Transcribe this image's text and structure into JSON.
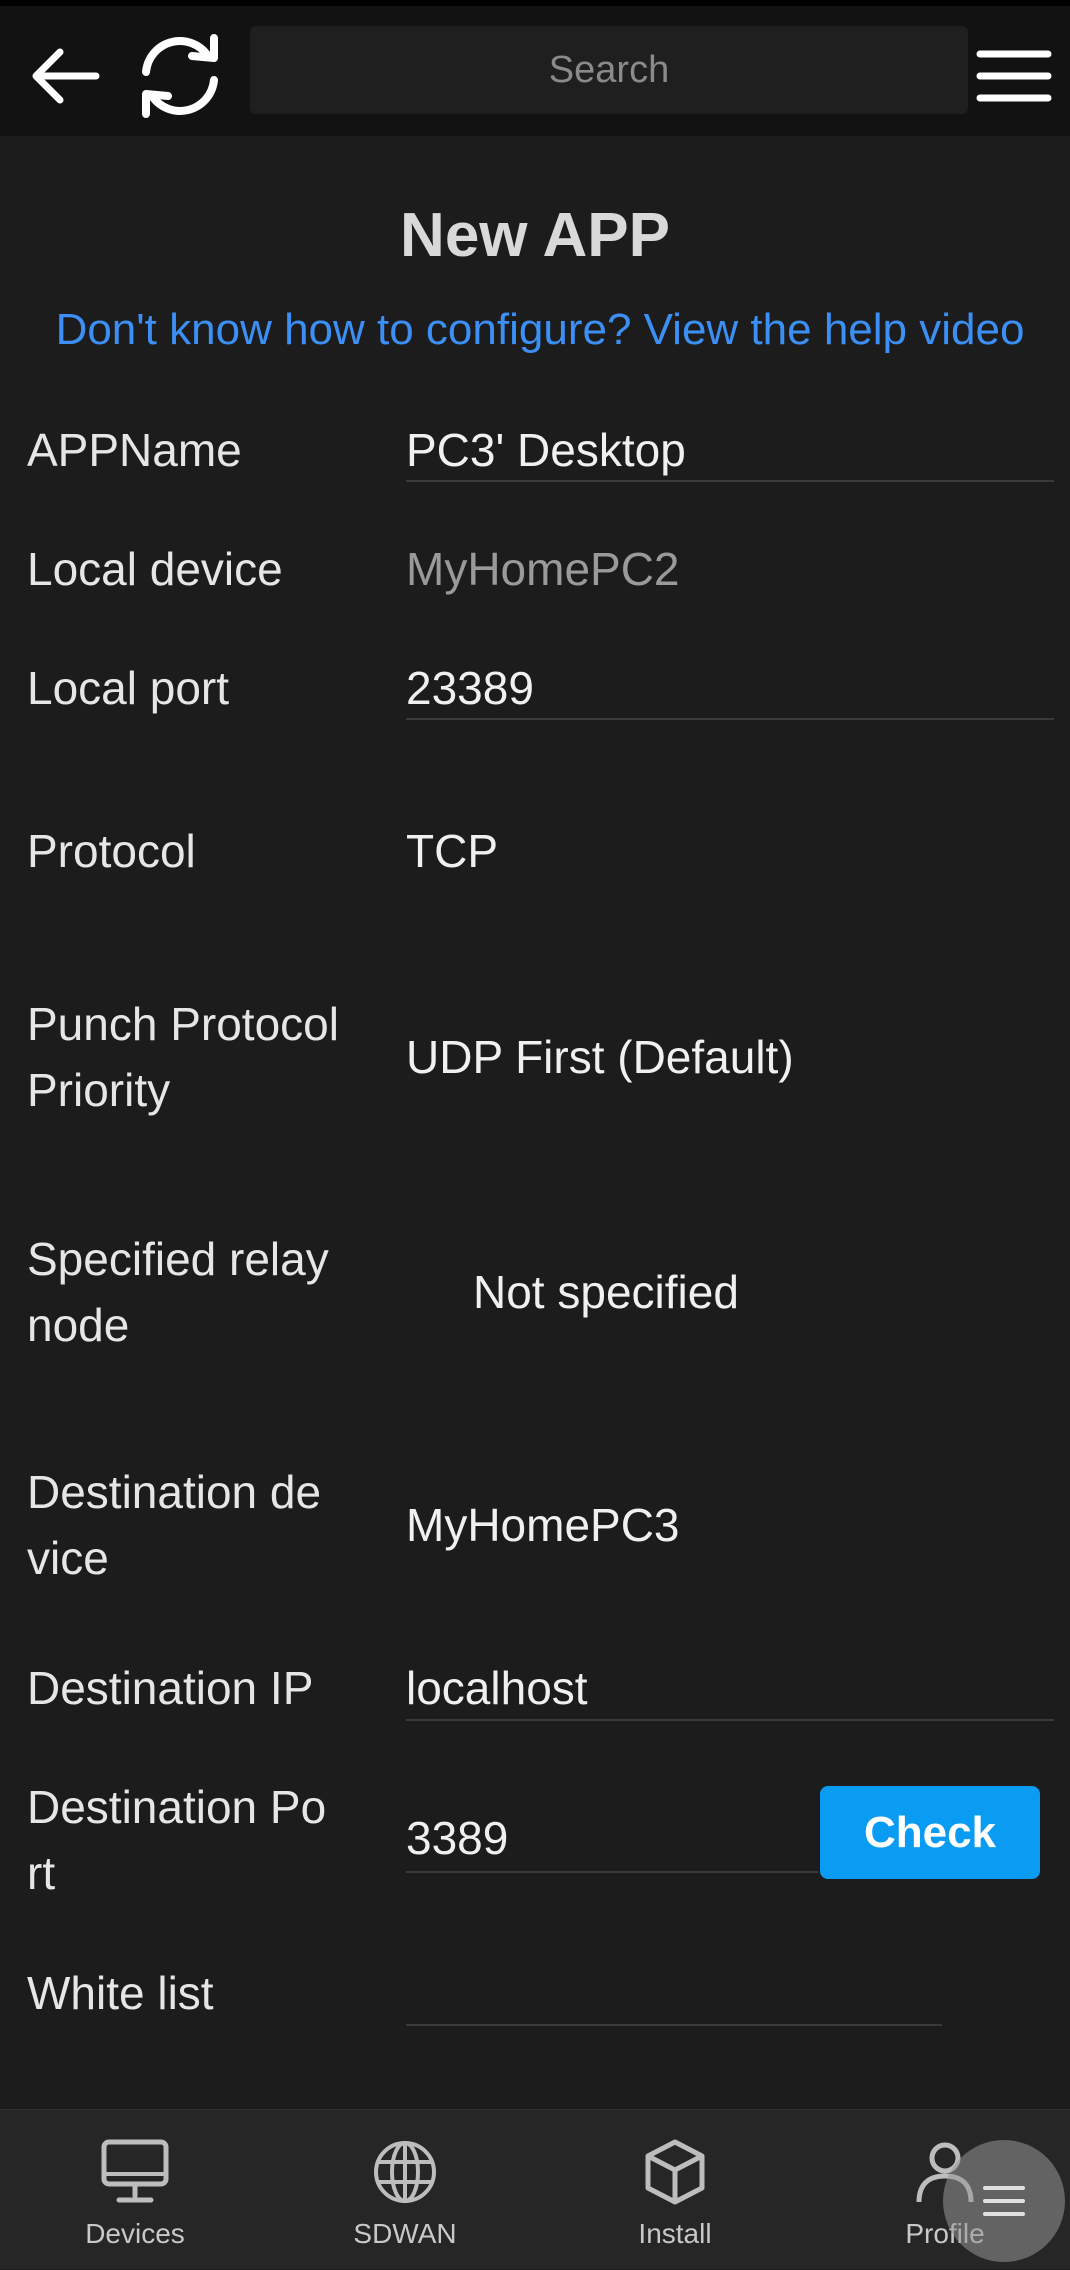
{
  "header": {
    "search_placeholder": "Search"
  },
  "page": {
    "title": "New APP",
    "help_link": "Don't know how to configure? View the help video"
  },
  "form": {
    "app_name": {
      "label": "APPName",
      "value": "PC3' Desktop"
    },
    "local_device": {
      "label": "Local device",
      "value": "MyHomePC2"
    },
    "local_port": {
      "label": "Local port",
      "value": "23389"
    },
    "protocol": {
      "label": "Protocol",
      "value": "TCP"
    },
    "punch_priority": {
      "label": "Punch Protocol Priority",
      "value": "UDP First (Default)"
    },
    "relay_node": {
      "label": "Specified relay node",
      "value": "Not specified"
    },
    "dest_device": {
      "label": "Destination de vice",
      "value": "MyHomePC3"
    },
    "dest_ip": {
      "label": "Destination IP",
      "value": "localhost"
    },
    "dest_port": {
      "label": "Destination Po rt",
      "value": "3389",
      "check_label": "Check"
    },
    "white_list": {
      "label": "White list",
      "value": ""
    }
  },
  "bottom_nav": {
    "items": [
      {
        "label": "Devices",
        "icon": "monitor-icon"
      },
      {
        "label": "SDWAN",
        "icon": "globe-icon"
      },
      {
        "label": "Install",
        "icon": "box-icon"
      },
      {
        "label": "Profile",
        "icon": "user-icon"
      }
    ]
  },
  "colors": {
    "background": "#1c1c1c",
    "link": "#3b8ff5",
    "accent_button": "#0a9bf2"
  }
}
